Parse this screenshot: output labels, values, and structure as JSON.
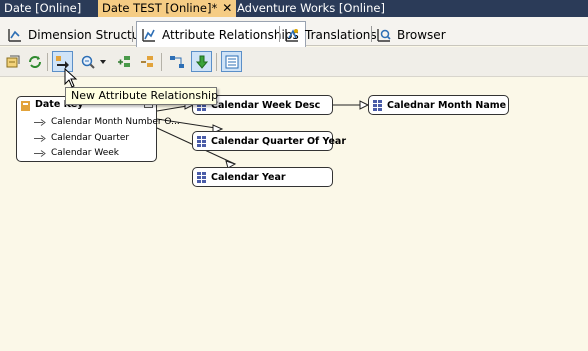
{
  "document_tabs": [
    {
      "label": "Date [Online]",
      "active": false
    },
    {
      "label": "Date TEST [Online]*",
      "active": true
    },
    {
      "label": "Adventure Works [Online]",
      "active": false
    }
  ],
  "designer_tabs": [
    {
      "label": "Dimension Structure",
      "icon": "dimension-structure-icon"
    },
    {
      "label": "Attribute Relationships",
      "icon": "attribute-relationships-icon",
      "active": true
    },
    {
      "label": "Translations",
      "icon": "translations-icon"
    },
    {
      "label": "Browser",
      "icon": "browser-icon"
    }
  ],
  "toolbar": {
    "buttons": [
      "process-icon",
      "refresh-icon",
      "new-attribute-relationship-icon",
      "zoom-icon",
      "zoom-dropdown-icon",
      "expand-icon",
      "collapse-icon",
      "arrange-icon",
      "move-down-icon",
      "show-list-icon"
    ],
    "tooltip": "New Attribute Relationship"
  },
  "diagram": {
    "key": {
      "title": "Date Key",
      "items": [
        "Calendar Month Number O...",
        "Calendar Quarter",
        "Calendar Week"
      ]
    },
    "attributes": {
      "week_desc": "Calendar Week Desc",
      "quarter_of_year": "Calendar Quarter Of Year",
      "year": "Calendar Year",
      "month_name": "Calednar Month Name"
    }
  },
  "colors": {
    "tab_strip": "#2b3b58",
    "active_doc_tab": "#f5cc84",
    "canvas": "#fbf8e8",
    "tooltip_bg": "#ffffe1"
  }
}
